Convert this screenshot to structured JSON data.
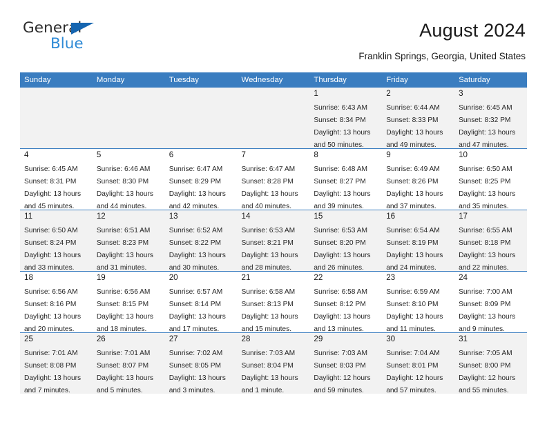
{
  "brand": {
    "word1": "General",
    "word2": "Blue",
    "triangle_color": "#1565b0",
    "word2_color": "#2e8ad6"
  },
  "header": {
    "title": "August 2024",
    "location": "Franklin Springs, Georgia, United States"
  },
  "calendar": {
    "header_bg": "#3a7dc0",
    "shade_bg": "#f2f2f2",
    "weekdays": [
      "Sunday",
      "Monday",
      "Tuesday",
      "Wednesday",
      "Thursday",
      "Friday",
      "Saturday"
    ],
    "weeks": [
      [
        {
          "day": "",
          "info": ""
        },
        {
          "day": "",
          "info": ""
        },
        {
          "day": "",
          "info": ""
        },
        {
          "day": "",
          "info": ""
        },
        {
          "day": "1",
          "info": "Sunrise: 6:43 AM\nSunset: 8:34 PM\nDaylight: 13 hours\nand 50 minutes."
        },
        {
          "day": "2",
          "info": "Sunrise: 6:44 AM\nSunset: 8:33 PM\nDaylight: 13 hours\nand 49 minutes."
        },
        {
          "day": "3",
          "info": "Sunrise: 6:45 AM\nSunset: 8:32 PM\nDaylight: 13 hours\nand 47 minutes."
        }
      ],
      [
        {
          "day": "4",
          "info": "Sunrise: 6:45 AM\nSunset: 8:31 PM\nDaylight: 13 hours\nand 45 minutes."
        },
        {
          "day": "5",
          "info": "Sunrise: 6:46 AM\nSunset: 8:30 PM\nDaylight: 13 hours\nand 44 minutes."
        },
        {
          "day": "6",
          "info": "Sunrise: 6:47 AM\nSunset: 8:29 PM\nDaylight: 13 hours\nand 42 minutes."
        },
        {
          "day": "7",
          "info": "Sunrise: 6:47 AM\nSunset: 8:28 PM\nDaylight: 13 hours\nand 40 minutes."
        },
        {
          "day": "8",
          "info": "Sunrise: 6:48 AM\nSunset: 8:27 PM\nDaylight: 13 hours\nand 39 minutes."
        },
        {
          "day": "9",
          "info": "Sunrise: 6:49 AM\nSunset: 8:26 PM\nDaylight: 13 hours\nand 37 minutes."
        },
        {
          "day": "10",
          "info": "Sunrise: 6:50 AM\nSunset: 8:25 PM\nDaylight: 13 hours\nand 35 minutes."
        }
      ],
      [
        {
          "day": "11",
          "info": "Sunrise: 6:50 AM\nSunset: 8:24 PM\nDaylight: 13 hours\nand 33 minutes."
        },
        {
          "day": "12",
          "info": "Sunrise: 6:51 AM\nSunset: 8:23 PM\nDaylight: 13 hours\nand 31 minutes."
        },
        {
          "day": "13",
          "info": "Sunrise: 6:52 AM\nSunset: 8:22 PM\nDaylight: 13 hours\nand 30 minutes."
        },
        {
          "day": "14",
          "info": "Sunrise: 6:53 AM\nSunset: 8:21 PM\nDaylight: 13 hours\nand 28 minutes."
        },
        {
          "day": "15",
          "info": "Sunrise: 6:53 AM\nSunset: 8:20 PM\nDaylight: 13 hours\nand 26 minutes."
        },
        {
          "day": "16",
          "info": "Sunrise: 6:54 AM\nSunset: 8:19 PM\nDaylight: 13 hours\nand 24 minutes."
        },
        {
          "day": "17",
          "info": "Sunrise: 6:55 AM\nSunset: 8:18 PM\nDaylight: 13 hours\nand 22 minutes."
        }
      ],
      [
        {
          "day": "18",
          "info": "Sunrise: 6:56 AM\nSunset: 8:16 PM\nDaylight: 13 hours\nand 20 minutes."
        },
        {
          "day": "19",
          "info": "Sunrise: 6:56 AM\nSunset: 8:15 PM\nDaylight: 13 hours\nand 18 minutes."
        },
        {
          "day": "20",
          "info": "Sunrise: 6:57 AM\nSunset: 8:14 PM\nDaylight: 13 hours\nand 17 minutes."
        },
        {
          "day": "21",
          "info": "Sunrise: 6:58 AM\nSunset: 8:13 PM\nDaylight: 13 hours\nand 15 minutes."
        },
        {
          "day": "22",
          "info": "Sunrise: 6:58 AM\nSunset: 8:12 PM\nDaylight: 13 hours\nand 13 minutes."
        },
        {
          "day": "23",
          "info": "Sunrise: 6:59 AM\nSunset: 8:10 PM\nDaylight: 13 hours\nand 11 minutes."
        },
        {
          "day": "24",
          "info": "Sunrise: 7:00 AM\nSunset: 8:09 PM\nDaylight: 13 hours\nand 9 minutes."
        }
      ],
      [
        {
          "day": "25",
          "info": "Sunrise: 7:01 AM\nSunset: 8:08 PM\nDaylight: 13 hours\nand 7 minutes."
        },
        {
          "day": "26",
          "info": "Sunrise: 7:01 AM\nSunset: 8:07 PM\nDaylight: 13 hours\nand 5 minutes."
        },
        {
          "day": "27",
          "info": "Sunrise: 7:02 AM\nSunset: 8:05 PM\nDaylight: 13 hours\nand 3 minutes."
        },
        {
          "day": "28",
          "info": "Sunrise: 7:03 AM\nSunset: 8:04 PM\nDaylight: 13 hours\nand 1 minute."
        },
        {
          "day": "29",
          "info": "Sunrise: 7:03 AM\nSunset: 8:03 PM\nDaylight: 12 hours\nand 59 minutes."
        },
        {
          "day": "30",
          "info": "Sunrise: 7:04 AM\nSunset: 8:01 PM\nDaylight: 12 hours\nand 57 minutes."
        },
        {
          "day": "31",
          "info": "Sunrise: 7:05 AM\nSunset: 8:00 PM\nDaylight: 12 hours\nand 55 minutes."
        }
      ]
    ]
  }
}
